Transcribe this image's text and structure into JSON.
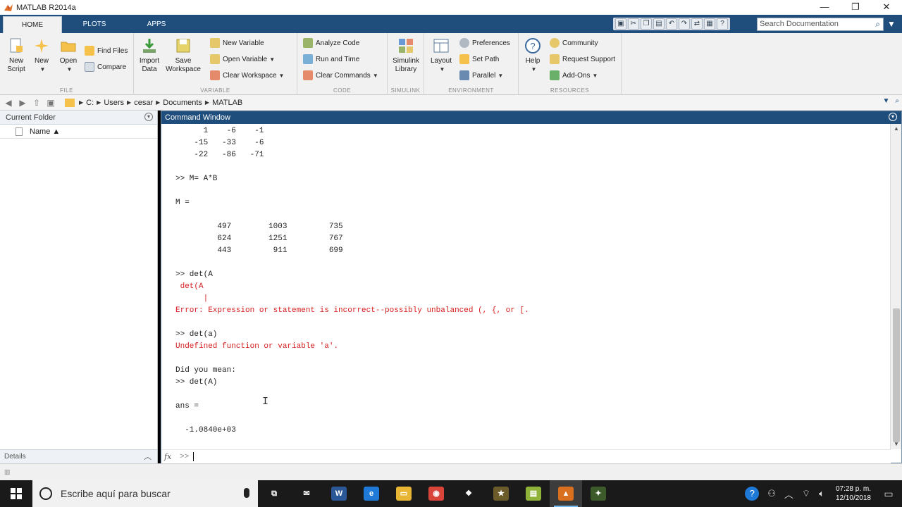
{
  "window": {
    "title": "MATLAB R2014a",
    "minimize_glyph": "—",
    "restore_glyph": "❐",
    "close_glyph": "✕"
  },
  "ribbon_tabs": [
    {
      "label": "HOME",
      "active": true
    },
    {
      "label": "PLOTS",
      "active": false
    },
    {
      "label": "APPS",
      "active": false
    }
  ],
  "search_doc": {
    "placeholder": "Search Documentation"
  },
  "ribbon": {
    "file": {
      "label": "FILE",
      "new_script": "New\nScript",
      "new": "New",
      "open": "Open",
      "find_files": "Find Files",
      "compare": "Compare"
    },
    "variable": {
      "label": "VARIABLE",
      "import_data": "Import\nData",
      "save_workspace": "Save\nWorkspace",
      "new_variable": "New Variable",
      "open_variable": "Open Variable",
      "clear_workspace": "Clear Workspace"
    },
    "code": {
      "label": "CODE",
      "analyze_code": "Analyze Code",
      "run_and_time": "Run and Time",
      "clear_commands": "Clear Commands"
    },
    "simulink": {
      "label": "SIMULINK",
      "simulink_library": "Simulink\nLibrary"
    },
    "environment": {
      "label": "ENVIRONMENT",
      "layout": "Layout",
      "preferences": "Preferences",
      "set_path": "Set Path",
      "parallel": "Parallel"
    },
    "resources": {
      "label": "RESOURCES",
      "help": "Help",
      "community": "Community",
      "request_support": "Request Support",
      "add_ons": "Add-Ons"
    }
  },
  "address": {
    "crumbs": [
      "C:",
      "Users",
      "cesar",
      "Documents",
      "MATLAB"
    ]
  },
  "current_folder": {
    "title": "Current Folder",
    "column_name": "Name ▲",
    "details_label": "Details"
  },
  "command_window": {
    "title": "Command Window",
    "lines": [
      {
        "text": "      1    -6    -1",
        "err": false
      },
      {
        "text": "    -15   -33    -6",
        "err": false
      },
      {
        "text": "    -22   -86   -71",
        "err": false
      },
      {
        "text": "",
        "err": false
      },
      {
        "text": ">> M= A*B",
        "err": false
      },
      {
        "text": "",
        "err": false
      },
      {
        "text": "M =",
        "err": false
      },
      {
        "text": "",
        "err": false
      },
      {
        "text": "         497        1003         735",
        "err": false
      },
      {
        "text": "         624        1251         767",
        "err": false
      },
      {
        "text": "         443         911         699",
        "err": false
      },
      {
        "text": "",
        "err": false
      },
      {
        "text": ">> det(A",
        "err": false
      },
      {
        "text": " det(A",
        "err": true
      },
      {
        "text": "      |",
        "err": true
      },
      {
        "text": "Error: Expression or statement is incorrect--possibly unbalanced (, {, or [.",
        "err": true
      },
      {
        "text": "",
        "err": false
      },
      {
        "text": ">> det(a)",
        "err": false
      },
      {
        "text": "Undefined function or variable 'a'.",
        "err": true
      },
      {
        "text": "",
        "err": false
      },
      {
        "text": "Did you mean:",
        "err": false
      },
      {
        "text": ">> det(A)",
        "err": false
      },
      {
        "text": "",
        "err": false
      },
      {
        "text": "ans =",
        "err": false
      },
      {
        "text": "",
        "err": false
      },
      {
        "text": "  -1.0840e+03",
        "err": false
      }
    ],
    "fx_label": "fx",
    "prompt": ">>"
  },
  "taskbar": {
    "search_placeholder": "Escribe aquí para buscar",
    "apps": [
      {
        "name": "task-view-icon",
        "glyph": "⧉",
        "color": "#1a1a1a",
        "running": false
      },
      {
        "name": "mail-icon",
        "glyph": "✉",
        "color": "#1a1a1a",
        "running": false
      },
      {
        "name": "word-icon",
        "glyph": "W",
        "color": "#2b5797",
        "running": false
      },
      {
        "name": "edge-icon",
        "glyph": "e",
        "color": "#1e7ad6",
        "running": false
      },
      {
        "name": "file-explorer-icon",
        "glyph": "▭",
        "color": "#e8b635",
        "running": false
      },
      {
        "name": "chrome-icon",
        "glyph": "◉",
        "color": "#d9453b",
        "running": false
      },
      {
        "name": "dropbox-icon",
        "glyph": "❖",
        "color": "#1a1a1a",
        "running": false
      },
      {
        "name": "star-app-icon",
        "glyph": "★",
        "color": "#6b5a2a",
        "running": false
      },
      {
        "name": "notes-app-icon",
        "glyph": "▤",
        "color": "#8fb33a",
        "running": false
      },
      {
        "name": "matlab-icon",
        "glyph": "▲",
        "color": "#d8701f",
        "running": true
      },
      {
        "name": "other-app-icon",
        "glyph": "✦",
        "color": "#3c5a2a",
        "running": false
      }
    ],
    "clock_time": "07:28 p. m.",
    "clock_date": "12/10/2018"
  }
}
